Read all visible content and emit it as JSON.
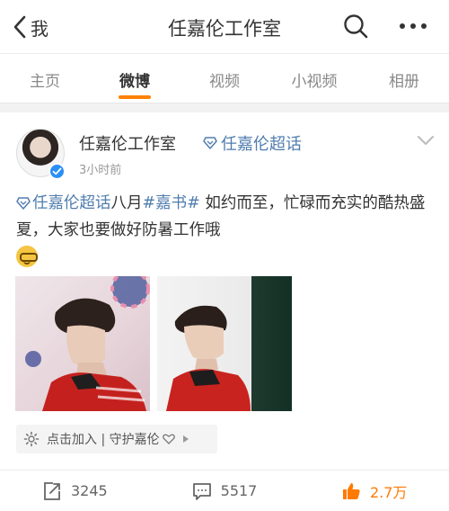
{
  "header": {
    "back_label": "我",
    "title": "任嘉伦工作室"
  },
  "tabs": [
    {
      "label": "主页",
      "active": false
    },
    {
      "label": "微博",
      "active": true
    },
    {
      "label": "视频",
      "active": false
    },
    {
      "label": "小视频",
      "active": false
    },
    {
      "label": "相册",
      "active": false
    }
  ],
  "post": {
    "author": "任嘉伦工作室",
    "topic": "任嘉伦超话",
    "time": "3小时前",
    "content": {
      "topic_link": "任嘉伦超话",
      "text_a": "八月",
      "hashtag": "#嘉书#",
      "text_b": " 如约而至，忙碌而充实的酷热盛夏，大家也要做好防暑工作哦"
    },
    "super_bar": {
      "label": "点击加入 | 守护嘉伦"
    },
    "actions": {
      "repost_count": "3245",
      "comment_count": "5517",
      "like_count": "2.7万"
    }
  },
  "colors": {
    "accent": "#ff8200",
    "link": "#507daf",
    "verify": "#2a8ff7",
    "like": "#ff7a00"
  },
  "icons": [
    "back-chevron-icon",
    "search-icon",
    "more-icon",
    "verified-icon",
    "diamond-icon",
    "chevron-down-icon",
    "sun-icon",
    "heart-icon",
    "triangle-right-icon",
    "repost-icon",
    "comment-icon",
    "like-icon",
    "nerd-emoji-icon"
  ]
}
